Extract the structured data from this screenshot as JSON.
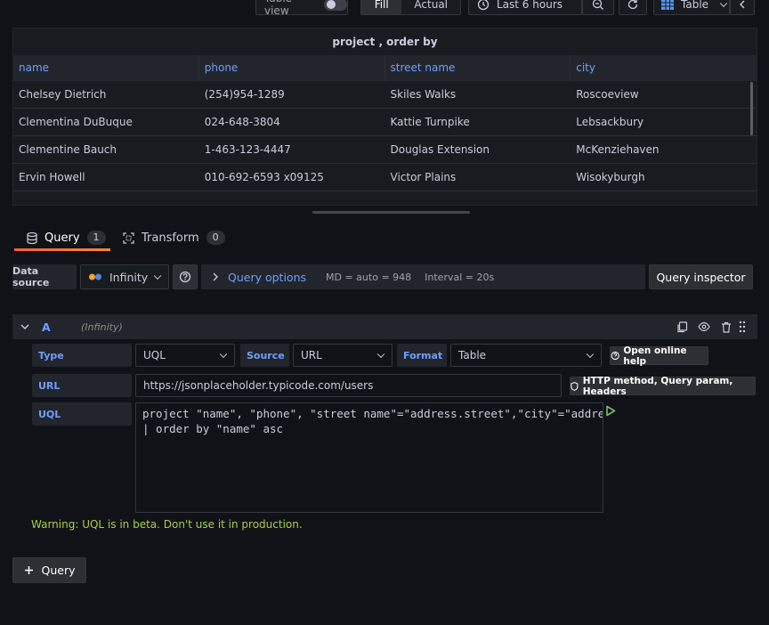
{
  "toolbar": {
    "table_view_label": "Table view",
    "fill_label": "Fill",
    "actual_label": "Actual",
    "time_range": "Last 6 hours",
    "viz_label": "Table"
  },
  "panel": {
    "title": "project , order by",
    "columns": [
      "name",
      "phone",
      "street name",
      "city"
    ],
    "rows": [
      [
        "Chelsey Dietrich",
        "(254)954-1289",
        "Skiles Walks",
        "Roscoeview"
      ],
      [
        "Clementina DuBuque",
        "024-648-3804",
        "Kattie Turnpike",
        "Lebsackbury"
      ],
      [
        "Clementine Bauch",
        "1-463-123-4447",
        "Douglas Extension",
        "McKenziehaven"
      ],
      [
        "Ervin Howell",
        "010-692-6593 x09125",
        "Victor Plains",
        "Wisokyburgh"
      ]
    ]
  },
  "tabs": [
    {
      "label": "Query",
      "count": "1"
    },
    {
      "label": "Transform",
      "count": "0"
    }
  ],
  "datasource": {
    "label": "Data source",
    "name": "Infinity",
    "query_options_label": "Query options",
    "md": "MD = auto = 948",
    "interval": "Interval = 20s",
    "inspector_label": "Query inspector"
  },
  "query": {
    "ref_id": "A",
    "ds_name": "(Infinity)",
    "type_label": "Type",
    "type_value": "UQL",
    "source_label": "Source",
    "source_value": "URL",
    "format_label": "Format",
    "format_value": "Table",
    "help_label": "Open online help",
    "url_label": "URL",
    "url_value": "https://jsonplaceholder.typicode.com/users",
    "http_label": "HTTP method, Query param, Headers",
    "uql_label": "UQL",
    "uql_line1": "project \"name\", \"phone\", \"street name\"=\"address.street\",\"city\"=\"address.city\"",
    "uql_line2": "| order by \"name\" asc",
    "warning": "Warning: UQL is in beta. Don't use it in production.",
    "add_label": "Query"
  },
  "colors": {
    "accent": "#6e9fff",
    "warning": "#a7d04d",
    "run": "#73bf69"
  }
}
